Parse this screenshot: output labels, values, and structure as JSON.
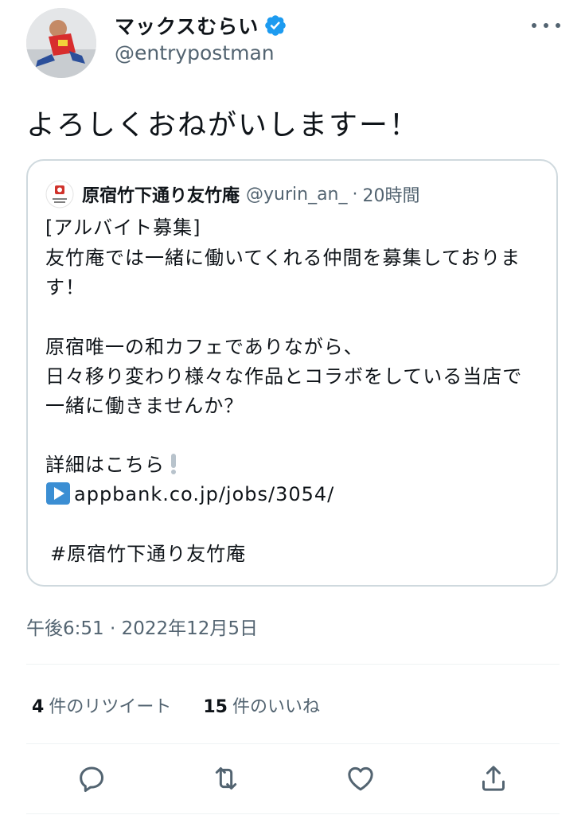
{
  "tweet": {
    "author": {
      "display_name": "マックスむらい",
      "handle": "@entrypostman",
      "verified": true
    },
    "text": "よろしくおねがいしますー！",
    "timestamp": "午後6:51 · 2022年12月5日",
    "stats": {
      "retweets": {
        "count": "4",
        "label": "件のリツイート"
      },
      "likes": {
        "count": "15",
        "label": "件のいいね"
      }
    }
  },
  "quote": {
    "author_name": "原宿竹下通り友竹庵",
    "handle": "@yurin_an_",
    "separator": "·",
    "time": "20時間",
    "lines": {
      "l1": "[アルバイト募集]",
      "l2": "友竹庵では一緒に働いてくれる仲間を募集しておりま",
      "l3": "す！",
      "l4": "原宿唯一の和カフェでありながら、",
      "l5": "日々移り変わり様々な作品とコラボをしている当店で",
      "l6": "一緒に働きませんか？",
      "l7": "詳細はこちら",
      "link": "appbank.co.jp/jobs/3054/",
      "hashtag": "#原宿竹下通り友竹庵"
    }
  },
  "colors": {
    "text": "#0f1419",
    "secondary": "#536471",
    "verified_blue": "#1d9bf0",
    "border": "#cfd9de"
  },
  "icons": {
    "more": "more-horizontal-icon",
    "reply": "reply-icon",
    "retweet": "retweet-icon",
    "like": "heart-icon",
    "share": "share-icon",
    "verified": "verified-badge-icon",
    "play": "play-button-emoji-icon",
    "exclamation": "exclamation-emoji-icon"
  }
}
